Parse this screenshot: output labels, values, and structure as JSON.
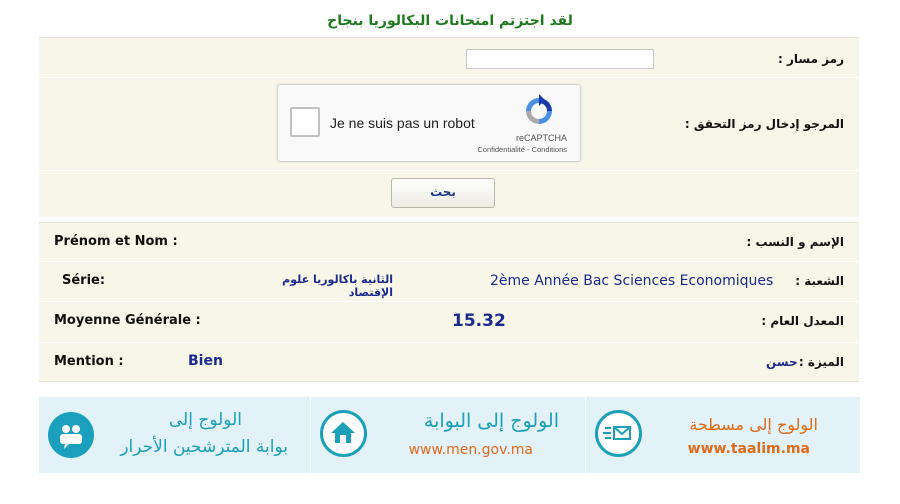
{
  "page": {
    "title": "لقد اجتزتم امتحانات البكالوريا بنجاح"
  },
  "form": {
    "code_label": "رمز مسار :",
    "captcha_label": "المرجو إدخال رمز التحقق :",
    "captcha": {
      "checkbox_text": "Je ne suis pas un robot",
      "brand": "reCAPTCHA",
      "links": "Confidentialité - Conditions"
    },
    "search_button": "بحث"
  },
  "result": {
    "name_label_fr": "Prénom et Nom :",
    "name_label_ar": "الإسم و النسب :",
    "serie_label_fr": "Série:",
    "serie_value_ar": "الثانية باكالوريا علوم الإقتصاد",
    "serie_value_fr": "2ème Année Bac Sciences Economiques",
    "serie_label_ar": "الشعبة :",
    "moyenne_label_fr": "Moyenne Générale :",
    "moyenne_value": "15.32",
    "moyenne_label_ar": "المعدل العام :",
    "mention_label_fr": "Mention :",
    "mention_value_fr": "Bien",
    "mention_value_ar": "حسن",
    "mention_label_ar": "الميزة :"
  },
  "banners": [
    {
      "line1": "الولوج إلى",
      "line2": "بوابة المترشحين الأحرار",
      "icon": "users-chat-icon"
    },
    {
      "line1": "الولوج إلى البوابة",
      "line2": "www.men.gov.ma",
      "icon": "home-icon"
    },
    {
      "line1": "الولوج إلى مسطحة",
      "line2": "www.taalim.ma",
      "icon": "mail-icon"
    }
  ],
  "colors": {
    "title_green": "#1f7a1f",
    "value_blue": "#1b2a8c",
    "panel_bg": "#f7f6e9",
    "banner_bg": "#e3f2f8",
    "teal": "#1aa0b8",
    "orange": "#e06a1a"
  }
}
